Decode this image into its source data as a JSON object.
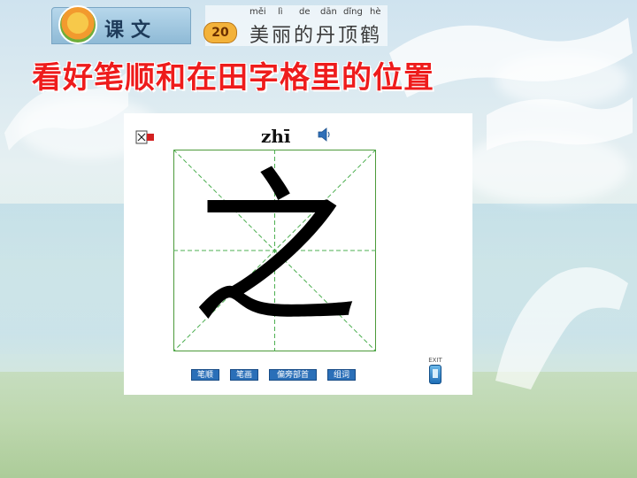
{
  "header": {
    "lesson_label": "课文",
    "lesson_number": "20",
    "pinyin": [
      "měi",
      "lì",
      "de",
      "dān",
      "dǐng",
      "hè"
    ],
    "lesson_title": "美丽的丹顶鹤"
  },
  "instruction": "看好笔顺和在田字格里的位置",
  "viewer": {
    "pinyin": "zhī",
    "character": "之",
    "buttons": [
      {
        "label": "笔顺"
      },
      {
        "label": "笔画"
      },
      {
        "label": "偏旁部首"
      },
      {
        "label": "组词"
      }
    ],
    "exit_label": "EXIT"
  },
  "colors": {
    "instruction_text": "#ee1c1c",
    "grid_border": "#4c9a3a",
    "grid_guides": "#4caf50",
    "button_fill": "#2a6fb8"
  },
  "icons": {
    "close": "close-icon",
    "speaker": "speaker-icon",
    "exit": "exit-icon"
  }
}
